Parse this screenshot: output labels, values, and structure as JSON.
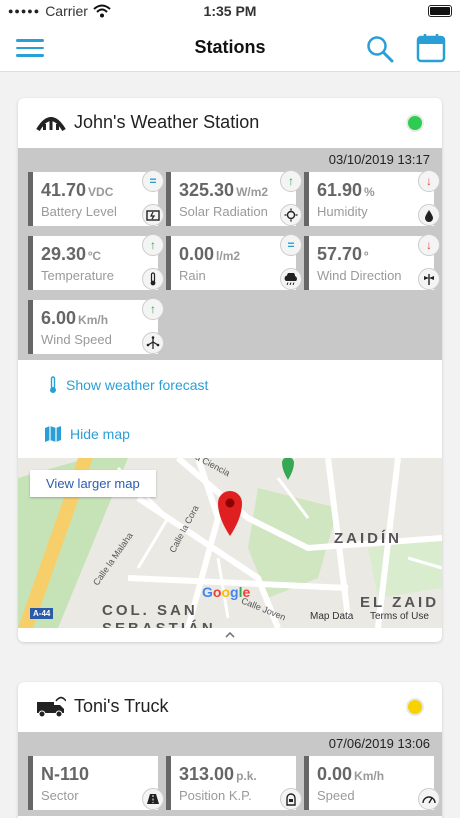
{
  "status_bar": {
    "carrier": "Carrier",
    "time": "1:35 PM"
  },
  "nav": {
    "title": "Stations",
    "menu_icon": "hamburger-menu-icon",
    "search_icon": "search-icon",
    "calendar_icon": "calendar-icon"
  },
  "colors": {
    "accent": "#2a9fd6",
    "trend_up": "#2cab46",
    "trend_down": "#e04a3a",
    "status_online": "#2ecc52",
    "status_warning": "#f5d200"
  },
  "stations": [
    {
      "name": "John's Weather Station",
      "type_icon": "weather-station-icon",
      "status_color": "green",
      "date": "03/10/2019 13:17",
      "readings": [
        {
          "value": "41.70",
          "unit": "VDC",
          "label": "Battery Level",
          "trend": "=",
          "trend_icon": "equal-icon",
          "kind_icon": "battery-icon"
        },
        {
          "value": "325.30",
          "unit": "W/m2",
          "label": "Solar Radiation",
          "trend": "↑",
          "trend_icon": "arrow-up-icon",
          "kind_icon": "sun-icon"
        },
        {
          "value": "61.90",
          "unit": "%",
          "label": "Humidity",
          "trend": "↓",
          "trend_icon": "arrow-down-icon",
          "kind_icon": "drop-icon"
        },
        {
          "value": "29.30",
          "unit": "ºC",
          "label": "Temperature",
          "trend": "↑",
          "trend_icon": "arrow-up-icon",
          "kind_icon": "thermometer-icon"
        },
        {
          "value": "0.00",
          "unit": "l/m2",
          "label": "Rain",
          "trend": "=",
          "trend_icon": "equal-icon",
          "kind_icon": "rain-cloud-icon"
        },
        {
          "value": "57.70",
          "unit": "º",
          "label": "Wind Direction",
          "trend": "↓",
          "trend_icon": "arrow-down-icon",
          "kind_icon": "wind-vane-icon"
        },
        {
          "value": "6.00",
          "unit": "Km/h",
          "label": "Wind Speed",
          "trend": "↑",
          "trend_icon": "arrow-up-icon",
          "kind_icon": "anemometer-icon"
        }
      ],
      "forecast_link": "Show weather forecast",
      "map_link": "Hide map",
      "map": {
        "larger_map": "View larger map",
        "streets": [
          "a Ciencia",
          "Calle la Cora",
          "Calle la Malaha",
          "Calle Joven"
        ],
        "districts": [
          "ZAIDÍN",
          "EL ZAID",
          "COL. SAN",
          "SEBASTIÁN"
        ],
        "highway": "A-44",
        "google": "Google",
        "map_data": "Map Data",
        "terms": "Terms of Use"
      }
    },
    {
      "name": "Toni's Truck",
      "type_icon": "truck-icon",
      "status_color": "yellow",
      "date": "07/06/2019 13:06",
      "readings": [
        {
          "value": "N-110",
          "unit": "",
          "label": "Sector",
          "kind_icon": "road-icon"
        },
        {
          "value": "313.00",
          "unit": "p.k.",
          "label": "Position K.P.",
          "kind_icon": "milestone-icon"
        },
        {
          "value": "0.00",
          "unit": "Km/h",
          "label": "Speed",
          "kind_icon": "speedometer-icon"
        }
      ]
    }
  ]
}
